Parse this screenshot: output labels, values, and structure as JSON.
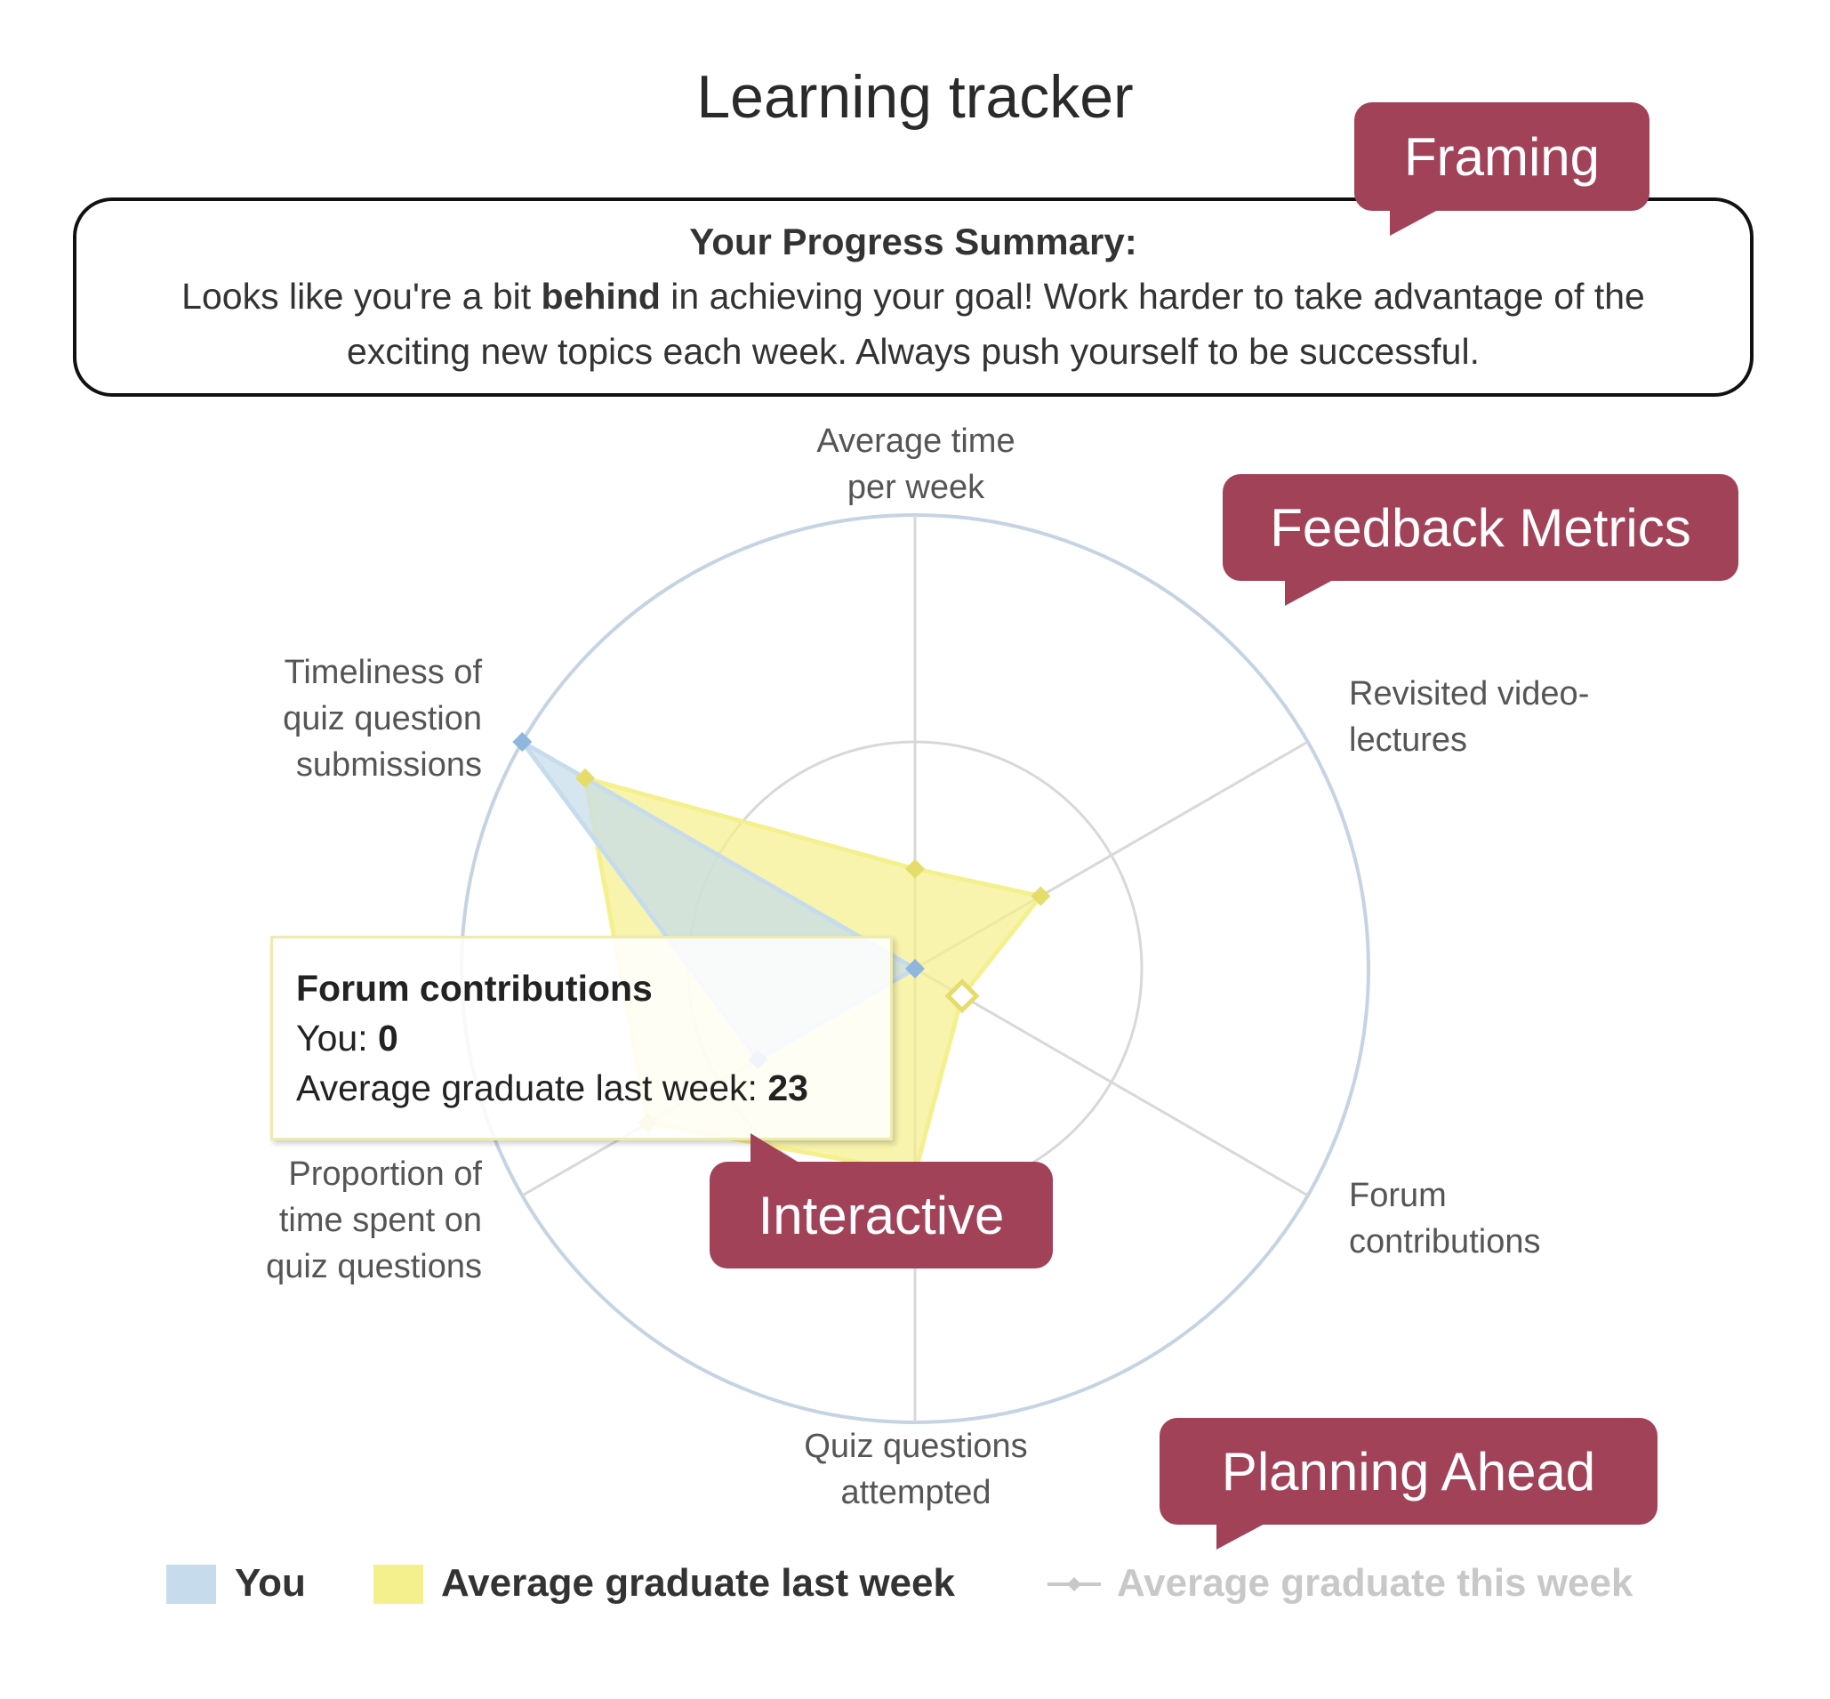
{
  "page": {
    "title": "Learning tracker"
  },
  "summary": {
    "heading": "Your Progress Summary:",
    "text_before": "Looks like you're a bit ",
    "text_bold": "behind",
    "text_after": " in achieving your goal! Work harder to take advantage of the exciting new topics each week. Always push yourself to be successful."
  },
  "callouts": {
    "framing": "Framing",
    "feedback_metrics": "Feedback Metrics",
    "interactive": "Interactive",
    "planning_ahead": "Planning Ahead",
    "color": "#a24259"
  },
  "tooltip": {
    "title": "Forum contributions",
    "you_label": "You: ",
    "you_value": "0",
    "avg_label": "Average graduate last week: ",
    "avg_value": "23"
  },
  "chart_data": {
    "type": "radar",
    "axes": [
      {
        "line1": "Average time",
        "line2": "per week",
        "line3": ""
      },
      {
        "line1": "Revisited video-",
        "line2": "lectures",
        "line3": ""
      },
      {
        "line1": "Forum",
        "line2": "contributions",
        "line3": ""
      },
      {
        "line1": "Quiz questions",
        "line2": "attempted",
        "line3": ""
      },
      {
        "line1": "Proportion of",
        "line2": "time spent on",
        "line3": "quiz questions"
      },
      {
        "line1": "Timeliness of",
        "line2": "quiz question",
        "line3": "submissions"
      }
    ],
    "scale_max": 1,
    "grid_rings": [
      0.5,
      1.0
    ],
    "series": [
      {
        "name": "You",
        "color": "#c6dcec",
        "marker_color": "#8fb6dc",
        "values": [
          0,
          0,
          0,
          0,
          0.4,
          1.0
        ]
      },
      {
        "name": "Average graduate last week",
        "color": "#f5f08e",
        "marker_color": "#e6dc6a",
        "values": [
          0.22,
          0.32,
          0.12,
          0.45,
          0.68,
          0.84
        ]
      }
    ],
    "highlighted_axis": "Forum contributions",
    "legend": [
      {
        "label": "You",
        "color": "#c6dcec",
        "style": "swatch"
      },
      {
        "label": "Average graduate last week",
        "color": "#f5f08e",
        "style": "swatch"
      },
      {
        "label": "Average graduate this week",
        "color": "#c8c8c8",
        "style": "line-marker",
        "disabled": true
      }
    ],
    "legend_position": "bottom"
  }
}
